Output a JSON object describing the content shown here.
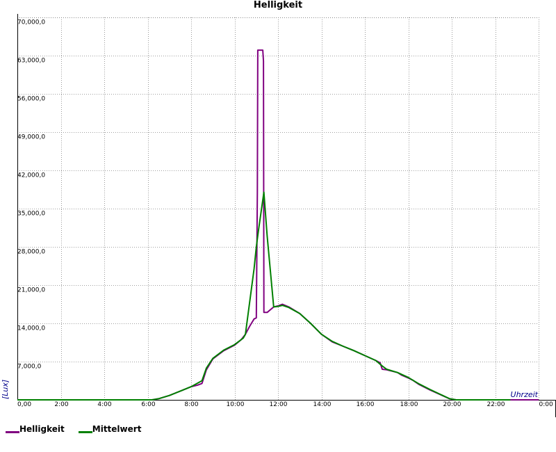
{
  "chart_data": {
    "type": "line",
    "title": "Helligkeit",
    "xlabel": "Uhrzeit",
    "ylabel": "[Lux]",
    "xlim": [
      0,
      24
    ],
    "ylim": [
      0,
      70000
    ],
    "grid": true,
    "legend_position": "bottom-left",
    "x_tick_labels": [
      "0:00",
      "2:00",
      "4:00",
      "6:00",
      "8:00",
      "10:00",
      "12:00",
      "14:00",
      "16:00",
      "18:00",
      "20:00",
      "22:00",
      "0:00"
    ],
    "y_tick_labels": [
      "0,00",
      "7,000,0",
      "14,000,0",
      "21,000,0",
      "28,000,0",
      "35,000,0",
      "42,000,0",
      "49,000,0",
      "56,000,0",
      "63,000,0",
      "70,000,0"
    ],
    "series": [
      {
        "name": "Helligkeit",
        "color": "#800080",
        "points": [
          [
            0,
            0
          ],
          [
            5.9,
            0
          ],
          [
            6.2,
            0
          ],
          [
            6.5,
            200
          ],
          [
            7.0,
            800
          ],
          [
            7.5,
            1600
          ],
          [
            8.0,
            2400
          ],
          [
            8.3,
            2700
          ],
          [
            8.5,
            3000
          ],
          [
            8.7,
            5500
          ],
          [
            9.0,
            7500
          ],
          [
            9.5,
            9000
          ],
          [
            10.0,
            10000
          ],
          [
            10.3,
            11000
          ],
          [
            10.5,
            12000
          ],
          [
            10.7,
            13500
          ],
          [
            10.9,
            14800
          ],
          [
            11.0,
            15000
          ],
          [
            11.05,
            38000
          ],
          [
            11.07,
            64000
          ],
          [
            11.3,
            64000
          ],
          [
            11.33,
            62000
          ],
          [
            11.35,
            16000
          ],
          [
            11.5,
            16000
          ],
          [
            11.8,
            17000
          ],
          [
            12.0,
            17200
          ],
          [
            12.2,
            17500
          ],
          [
            12.5,
            17000
          ],
          [
            13.0,
            15800
          ],
          [
            13.5,
            14000
          ],
          [
            14.0,
            12000
          ],
          [
            14.5,
            10600
          ],
          [
            15.0,
            9800
          ],
          [
            15.5,
            9000
          ],
          [
            16.0,
            8100
          ],
          [
            16.5,
            7200
          ],
          [
            16.7,
            6800
          ],
          [
            16.8,
            5600
          ],
          [
            17.0,
            5500
          ],
          [
            17.5,
            5000
          ],
          [
            17.7,
            4500
          ],
          [
            18.0,
            4000
          ],
          [
            18.2,
            3600
          ],
          [
            18.5,
            2800
          ],
          [
            19.0,
            1800
          ],
          [
            19.5,
            900
          ],
          [
            19.9,
            200
          ],
          [
            20.2,
            0
          ],
          [
            22.0,
            0
          ],
          [
            24.0,
            0
          ]
        ]
      },
      {
        "name": "Mittelwert",
        "color": "#008000",
        "points": [
          [
            0,
            0
          ],
          [
            5.9,
            0
          ],
          [
            6.2,
            0
          ],
          [
            6.5,
            200
          ],
          [
            7.0,
            800
          ],
          [
            7.5,
            1600
          ],
          [
            8.0,
            2400
          ],
          [
            8.5,
            3500
          ],
          [
            8.7,
            5800
          ],
          [
            9.0,
            7600
          ],
          [
            9.5,
            9100
          ],
          [
            10.0,
            10100
          ],
          [
            10.4,
            11300
          ],
          [
            10.5,
            12000
          ],
          [
            10.9,
            24000
          ],
          [
            11.0,
            28000
          ],
          [
            11.1,
            31000
          ],
          [
            11.35,
            38000
          ],
          [
            11.5,
            30000
          ],
          [
            11.8,
            17000
          ],
          [
            12.0,
            17100
          ],
          [
            12.2,
            17300
          ],
          [
            12.5,
            16900
          ],
          [
            13.0,
            15800
          ],
          [
            13.5,
            14000
          ],
          [
            14.0,
            12000
          ],
          [
            14.5,
            10700
          ],
          [
            15.0,
            9800
          ],
          [
            15.5,
            9000
          ],
          [
            16.0,
            8100
          ],
          [
            16.5,
            7200
          ],
          [
            16.8,
            6200
          ],
          [
            17.0,
            5600
          ],
          [
            17.5,
            5000
          ],
          [
            18.0,
            4100
          ],
          [
            18.5,
            2900
          ],
          [
            19.0,
            1900
          ],
          [
            19.5,
            950
          ],
          [
            19.9,
            200
          ],
          [
            20.2,
            0
          ],
          [
            22.0,
            0
          ],
          [
            22.7,
            0
          ]
        ]
      }
    ]
  }
}
